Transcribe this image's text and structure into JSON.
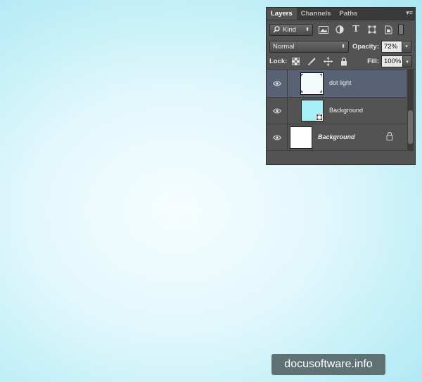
{
  "panel": {
    "tabs": [
      "Layers",
      "Channels",
      "Paths"
    ],
    "active_tab": "Layers",
    "menu_glyph": "▾≡"
  },
  "filter": {
    "kind_label": "Kind",
    "icons": [
      "image-filter-icon",
      "adjustment-filter-icon",
      "type-filter-icon",
      "shape-filter-icon",
      "smart-object-filter-icon"
    ]
  },
  "blend": {
    "mode": "Normal",
    "opacity_label": "Opacity:",
    "opacity_value": "72%"
  },
  "lock": {
    "label": "Lock:",
    "fill_label": "Fill:",
    "fill_value": "100%"
  },
  "layers": [
    {
      "name": "dot light",
      "selected": true,
      "visible": true,
      "italic": false
    },
    {
      "name": "Background",
      "selected": false,
      "visible": true,
      "italic": false,
      "thumb_color": "#a6eff6"
    },
    {
      "name": "Background",
      "selected": false,
      "visible": true,
      "italic": true,
      "locked": true
    }
  ],
  "watermark": "docusoftware.info"
}
